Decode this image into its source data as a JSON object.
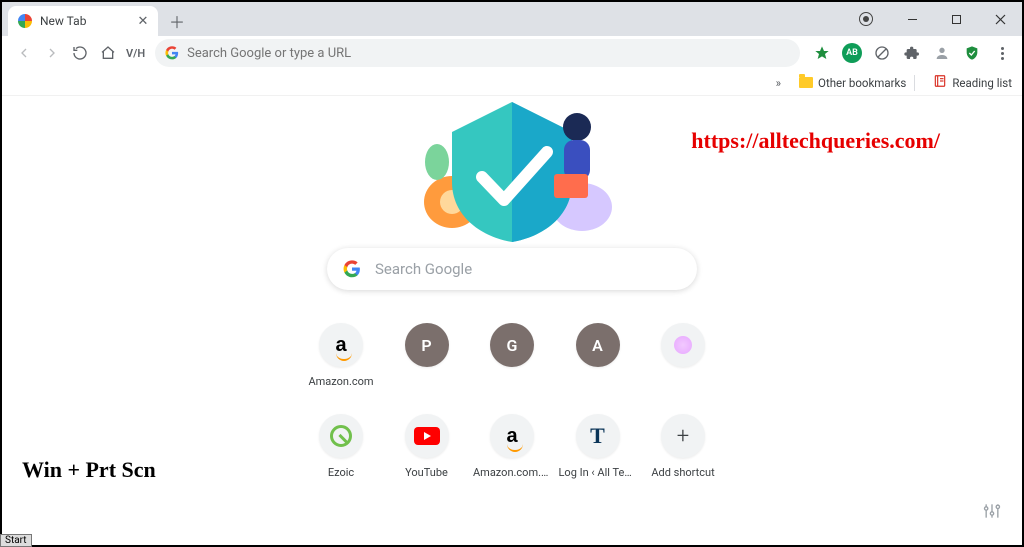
{
  "tab": {
    "title": "New Tab"
  },
  "omnibox": {
    "placeholder": "Search Google or type a URL",
    "vhost_label": "V/H"
  },
  "ext_badge_label": "AB",
  "bookmarks": {
    "overflow_glyph": "»",
    "other_label": "Other bookmarks",
    "reading_label": "Reading list"
  },
  "watermark_url": "https://alltechqueries.com/",
  "keyboard_hint": "Win + Prt Scn",
  "search": {
    "placeholder": "Search Google"
  },
  "shortcuts_row1": [
    {
      "label": "Amazon.com",
      "kind": "amazon"
    },
    {
      "label": "",
      "kind": "letter",
      "letter": "P"
    },
    {
      "label": "",
      "kind": "letter",
      "letter": "G"
    },
    {
      "label": "",
      "kind": "letter",
      "letter": "A"
    },
    {
      "label": "",
      "kind": "blob"
    }
  ],
  "shortcuts_row2": [
    {
      "label": "Ezoic",
      "kind": "ezoic"
    },
    {
      "label": "YouTube",
      "kind": "youtube"
    },
    {
      "label": "Amazon.com. ...",
      "kind": "amazon"
    },
    {
      "label": "Log In ‹ All Tec...",
      "kind": "t"
    },
    {
      "label": "Add shortcut",
      "kind": "plus"
    }
  ],
  "start_button_label": "Start"
}
